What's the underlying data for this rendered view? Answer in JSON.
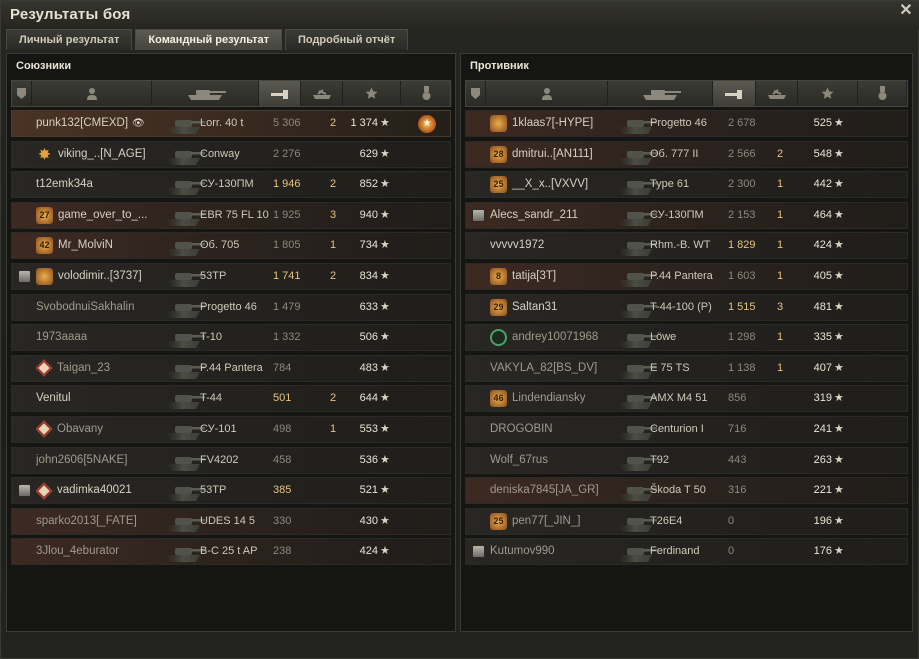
{
  "window": {
    "title": "Результаты боя",
    "close_glyph": "✕"
  },
  "tabs": [
    {
      "label": "Личный результат",
      "active": false
    },
    {
      "label": "Командный результат",
      "active": true
    },
    {
      "label": "Подробный отчёт",
      "active": false
    }
  ],
  "star_glyph": "★",
  "allies": {
    "title": "Союзники",
    "rows": [
      {
        "name": "punk132[CMEXD]",
        "vehicle": "Lorr. 40 t",
        "damage": "5 306",
        "kills": "2",
        "xp": "1 374",
        "self": true,
        "award": true,
        "eye": true
      },
      {
        "name": "viking_..[N_AGE]",
        "vehicle": "Conway",
        "damage": "2 276",
        "kills": "",
        "xp": "629",
        "ach": "star"
      },
      {
        "name": "t12emk34a",
        "vehicle": "СУ-130ПМ",
        "damage": "1 946",
        "kills": "2",
        "xp": "852",
        "gold": true
      },
      {
        "name": "game_over_to_...",
        "vehicle": "EBR 75 FL 10",
        "damage": "1 925",
        "kills": "3",
        "xp": "940",
        "ach": "mark",
        "ach_text": "27",
        "red": true
      },
      {
        "name": "Mr_MolviN",
        "vehicle": "Об. 705",
        "damage": "1 805",
        "kills": "1",
        "xp": "734",
        "ach": "mark",
        "ach_text": "42",
        "red": true
      },
      {
        "name": "volodimir..[3737]",
        "vehicle": "53TP",
        "damage": "1 741",
        "kills": "2",
        "xp": "834",
        "platoon": true,
        "ach": "mark",
        "ach_text": "",
        "gold": true
      },
      {
        "name": "SvobodnuiSakhalin",
        "vehicle": "Progetto 46",
        "damage": "1 479",
        "kills": "",
        "xp": "633",
        "dim": true
      },
      {
        "name": "1973aaaa",
        "vehicle": "T-10",
        "damage": "1 332",
        "kills": "",
        "xp": "506",
        "dim": true
      },
      {
        "name": "Taigan_23",
        "vehicle": "P.44 Pantera",
        "damage": "784",
        "kills": "",
        "xp": "483",
        "ach": "diamond",
        "dim": true
      },
      {
        "name": "Venitul",
        "vehicle": "T-44",
        "damage": "501",
        "kills": "2",
        "xp": "644",
        "gold": true
      },
      {
        "name": "Obavany",
        "vehicle": "СУ-101",
        "damage": "498",
        "kills": "1",
        "xp": "553",
        "ach": "diamond",
        "dim": true
      },
      {
        "name": "john2606[5NAKE]",
        "vehicle": "FV4202",
        "damage": "458",
        "kills": "",
        "xp": "536",
        "dim": true
      },
      {
        "name": "vadimka40021",
        "vehicle": "53TP",
        "damage": "385",
        "kills": "",
        "xp": "521",
        "platoon": true,
        "ach": "diamond",
        "gold": true
      },
      {
        "name": "sparko2013[_FATE]",
        "vehicle": "UDES 14 5",
        "damage": "330",
        "kills": "",
        "xp": "430",
        "red": true,
        "dim": true
      },
      {
        "name": "3Jlou_4eburator",
        "vehicle": "В-С 25 t AP",
        "damage": "238",
        "kills": "",
        "xp": "424",
        "red": true,
        "dim": true
      }
    ]
  },
  "enemies": {
    "title": "Противник",
    "rows": [
      {
        "name": "1klaas7[-HYPE]",
        "vehicle": "Progetto 46",
        "damage": "2 678",
        "kills": "",
        "xp": "525",
        "ach": "mark",
        "ach_text": "",
        "red": true
      },
      {
        "name": "dmitrui..[AN111]",
        "vehicle": "Об. 777 II",
        "damage": "2 566",
        "kills": "2",
        "xp": "548",
        "ach": "mark",
        "ach_text": "28",
        "red": true
      },
      {
        "name": "__X_x..[VXVV]",
        "vehicle": "Type 61",
        "damage": "2 300",
        "kills": "1",
        "xp": "442",
        "ach": "mark",
        "ach_text": "25"
      },
      {
        "name": "Alecs_sandr_211",
        "vehicle": "СУ-130ПМ",
        "damage": "2 153",
        "kills": "1",
        "xp": "464",
        "platoon": true,
        "red": true
      },
      {
        "name": "vvvvv1972",
        "vehicle": "Rhm.-B. WT",
        "damage": "1 829",
        "kills": "1",
        "xp": "424",
        "gold": true
      },
      {
        "name": "tatija[3T]",
        "vehicle": "P.44 Pantera",
        "damage": "1 603",
        "kills": "1",
        "xp": "405",
        "ach": "mark",
        "ach_text": "8",
        "red": true
      },
      {
        "name": "Saltan31",
        "vehicle": "T-44-100 (Р)",
        "damage": "1 515",
        "kills": "3",
        "xp": "481",
        "ach": "mark",
        "ach_text": "29",
        "gold": true
      },
      {
        "name": "andrey10071968",
        "vehicle": "Löwe",
        "damage": "1 298",
        "kills": "1",
        "xp": "335",
        "ach": "ring",
        "dim": true
      },
      {
        "name": "VAKYLA_82[BS_DV]",
        "vehicle": "E 75 TS",
        "damage": "1 138",
        "kills": "1",
        "xp": "407",
        "dim": true
      },
      {
        "name": "Lindendiansky",
        "vehicle": "AMX M4 51",
        "damage": "856",
        "kills": "",
        "xp": "319",
        "ach": "mark",
        "ach_text": "46",
        "dim": true
      },
      {
        "name": "DROGOBIN",
        "vehicle": "Centurion I",
        "damage": "716",
        "kills": "",
        "xp": "241",
        "dim": true
      },
      {
        "name": "Wolf_67rus",
        "vehicle": "T92",
        "damage": "443",
        "kills": "",
        "xp": "263",
        "dim": true
      },
      {
        "name": "deniska7845[JA_GR]",
        "vehicle": "Škoda T 50",
        "damage": "316",
        "kills": "",
        "xp": "221",
        "red": true,
        "dim": true
      },
      {
        "name": "pen77[_JIN_]",
        "vehicle": "T26E4",
        "damage": "0",
        "kills": "",
        "xp": "196",
        "ach": "mark",
        "ach_text": "25",
        "dim": true
      },
      {
        "name": "Kutumov990",
        "vehicle": "Ferdinand",
        "damage": "0",
        "kills": "",
        "xp": "176",
        "platoon": true,
        "dim": true
      }
    ]
  }
}
